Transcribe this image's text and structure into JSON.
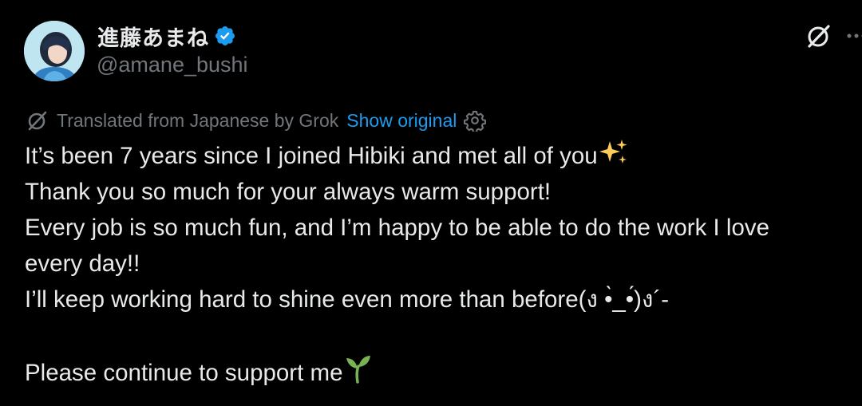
{
  "author": {
    "display_name": "進藤あまね",
    "handle": "@amane_bushi",
    "verified": true,
    "verified_color": "#1d9bf0"
  },
  "header_icons": [
    "grok-icon",
    "more-options-icon"
  ],
  "translation": {
    "label": "Translated from Japanese by Grok",
    "show_original": "Show original",
    "label_color": "#71767b",
    "link_color": "#1d9bf0"
  },
  "tweet": {
    "lines": [
      " It’s been 7 years since I joined Hibiki and met all of you",
      "Thank you so much for your always warm support!",
      "Every job is so much fun, and I’m happy to be able to do the work I love",
      "every day!!",
      "I’ll keep working hard to shine even more than before(ง •̀_•́)ง´-",
      "",
      "Please continue to support me"
    ],
    "emojis": {
      "line_0": "sparkles-emoji",
      "line_6": "seedling-emoji"
    }
  },
  "colors": {
    "background": "#000000",
    "text": "#e7e9ea",
    "secondary": "#71767b"
  }
}
